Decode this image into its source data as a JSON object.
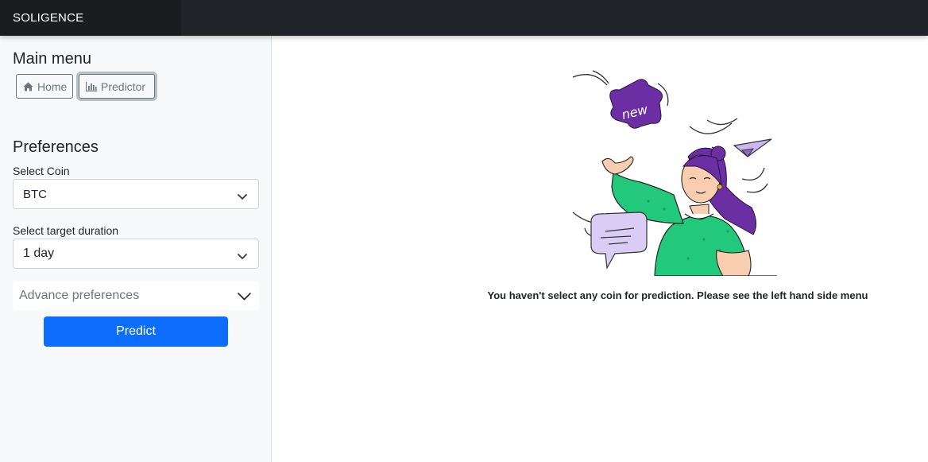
{
  "app": {
    "brand": "SOLIGENCE"
  },
  "sidebar": {
    "main_menu_title": "Main menu",
    "nav": [
      {
        "label": "Home",
        "icon": "home-icon"
      },
      {
        "label": "Predictor",
        "icon": "bar-chart-icon",
        "active": true
      }
    ],
    "preferences_title": "Preferences",
    "coin": {
      "label": "Select Coin",
      "value": "BTC"
    },
    "duration": {
      "label": "Select target duration",
      "value": "1 day"
    },
    "advanced": {
      "label": "Advance preferences"
    },
    "predict_label": "Predict"
  },
  "main": {
    "illustration_text": "new",
    "message": "You haven't select any coin for prediction. Please see the left hand side menu"
  },
  "colors": {
    "topbar": "#212529",
    "brand_bg": "#1a1d20",
    "sidebar_bg": "#f8f9fa",
    "primary": "#0d6efd",
    "purple": "#6b2fa3",
    "green": "#22c97a"
  }
}
